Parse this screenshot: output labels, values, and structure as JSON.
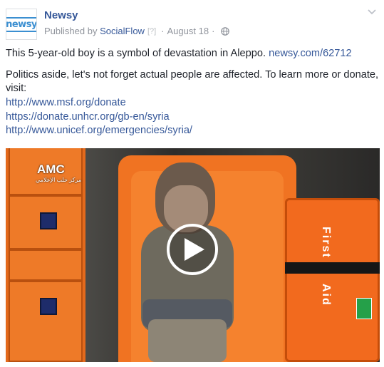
{
  "post": {
    "page_name": "Newsy",
    "avatar_text": "newsy",
    "published_by_prefix": "Published by",
    "publisher": "SocialFlow",
    "help_marker": "[?]",
    "separator": "·",
    "date": "August 18",
    "privacy_icon": "globe-icon",
    "menu_icon": "chevron-down-icon"
  },
  "content": {
    "line1_text": "This 5-year-old boy is a symbol of devastation in Aleppo.",
    "line1_link": "newsy.com/62712",
    "line2_text": "Politics aside, let's not forget actual people are affected. To learn more or donate, visit:",
    "links": [
      "http://www.msf.org/donate",
      "https://donate.unhcr.org/gb-en/syria",
      "http://www.unicef.org/emergencies/syria/"
    ]
  },
  "video": {
    "watermark": "AMC",
    "watermark_sub": "مركز حلب الإعلامي",
    "case_label_top": "First",
    "case_label_bottom": "Aid",
    "play_icon": "play-icon"
  },
  "colors": {
    "link": "#365899",
    "meta": "#90949c",
    "text": "#1d2129",
    "orange": "#f07322"
  }
}
